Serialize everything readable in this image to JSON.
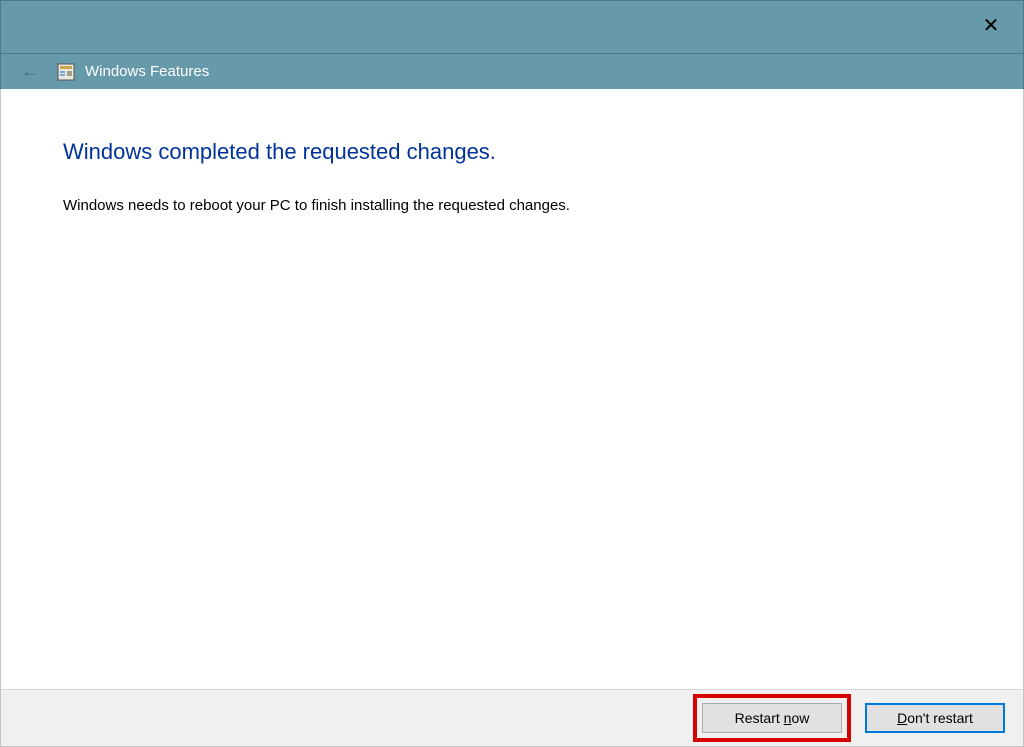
{
  "titlebar": {
    "close_label": "✕",
    "title": "Windows Features"
  },
  "content": {
    "headline": "Windows completed the requested changes.",
    "body": "Windows needs to reboot your PC to finish installing the requested changes."
  },
  "footer": {
    "restart_pre": "Restart ",
    "restart_u": "n",
    "restart_post": "ow",
    "dont_pre": "",
    "dont_u": "D",
    "dont_post": "on't restart"
  }
}
